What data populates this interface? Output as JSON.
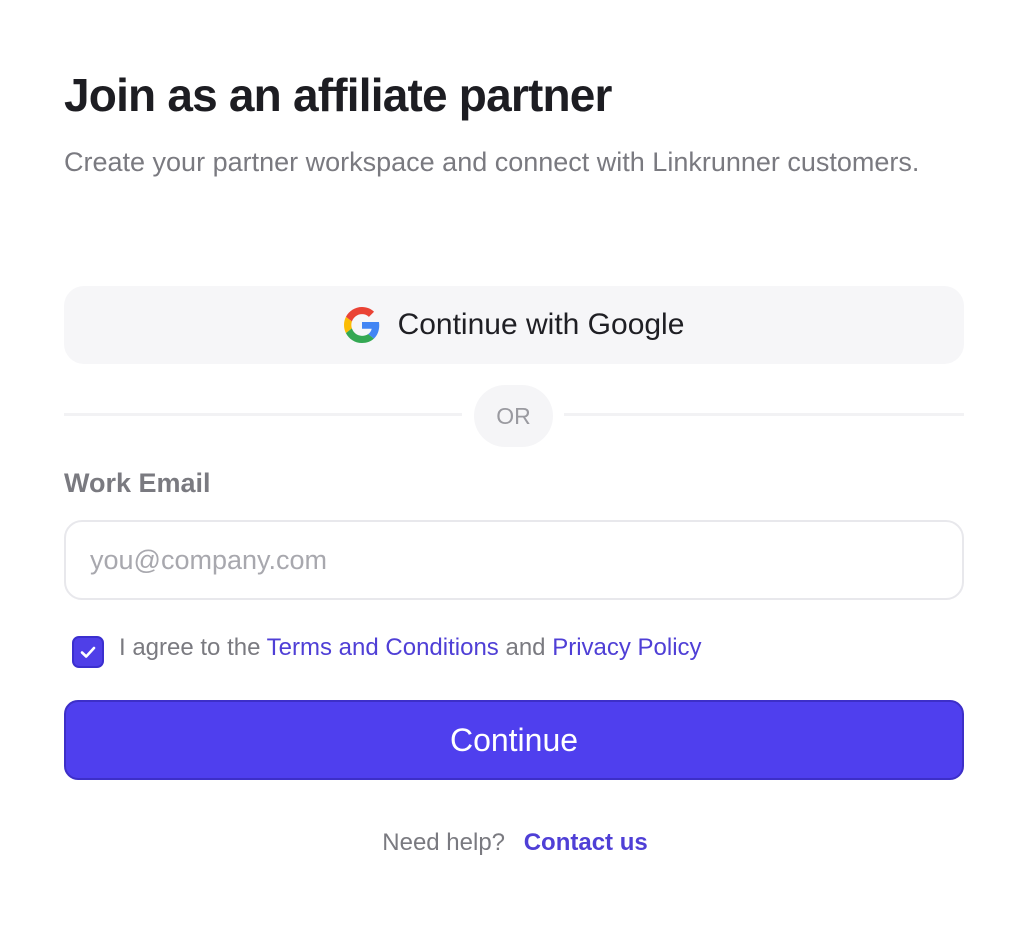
{
  "header": {
    "title": "Join as an affiliate partner",
    "subtitle": "Create your partner workspace and connect with Linkrunner customers."
  },
  "google_button": {
    "label": "Continue with Google",
    "icon": "google-g-icon"
  },
  "divider": {
    "text": "OR"
  },
  "email": {
    "label": "Work Email",
    "placeholder": "you@company.com",
    "value": ""
  },
  "agreement": {
    "checked": true,
    "prefix": "I agree to the",
    "terms_link": "Terms and Conditions",
    "conjunction": "and",
    "privacy_link": "Privacy Policy",
    "check_icon": "checkmark-icon"
  },
  "continue_button": {
    "label": "Continue"
  },
  "help": {
    "text": "Need help?",
    "link": "Contact us"
  },
  "colors": {
    "accent": "#4f3fee",
    "link": "#4f3fd6",
    "muted_text": "#7a7a80",
    "surface": "#f6f6f8"
  }
}
